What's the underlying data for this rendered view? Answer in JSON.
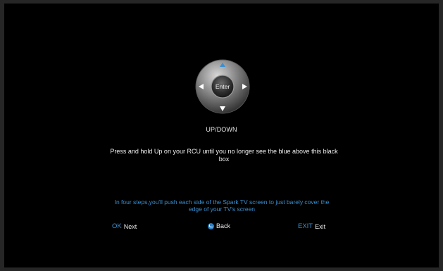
{
  "dpad": {
    "center_label": "Enter"
  },
  "step": {
    "label": "UP/DOWN"
  },
  "instruction": {
    "line1": "Press and hold Up on your RCU until you no longer see the blue above this black",
    "line2": "box"
  },
  "hint": {
    "line1": "In four steps,you'll push each side of the Spark TV screen to just barely cover the",
    "line2": "edge of your TV's screen"
  },
  "footer": {
    "ok_key": "OK",
    "ok_label": "Next",
    "back_label": "Back",
    "exit_key": "EXIT",
    "exit_label": "Exit"
  },
  "colors": {
    "accent": "#3a8fd0",
    "screen": "#000000",
    "text": "#e8e8e8"
  },
  "icons": {
    "up": "arrow-up-icon",
    "down": "arrow-down-icon",
    "left": "arrow-left-icon",
    "right": "arrow-right-icon",
    "back": "back-icon"
  }
}
